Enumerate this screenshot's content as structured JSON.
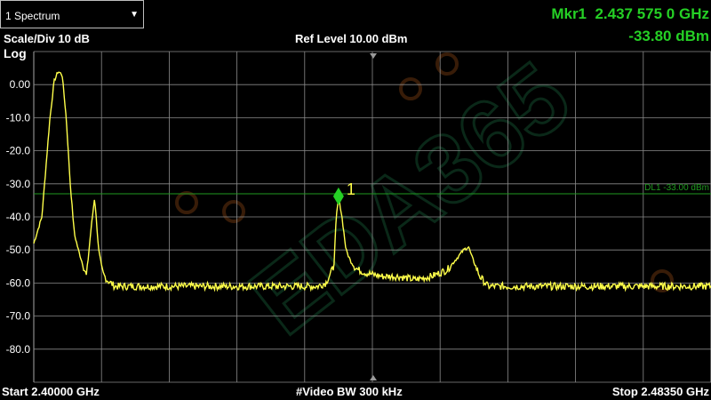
{
  "window": {
    "dropdown_label": "1 Spectrum"
  },
  "header": {
    "scale": "Scale/Div 10 dB",
    "ref_level": "Ref Level 10.00 dBm",
    "log": "Log",
    "marker_freq": "Mkr1  2.437 575 0 GHz",
    "marker_amp": "-33.80 dBm"
  },
  "footer": {
    "start": "Start 2.40000 GHz",
    "vbw": "#Video BW 300 kHz",
    "stop": "Stop 2.48350 GHz"
  },
  "display_line": {
    "label": "DL1 -33.00 dBm",
    "level": -33
  },
  "marker": {
    "label": "1",
    "freq_ghz": 2.437575,
    "amp_dbm": -33.8
  },
  "watermark": "EDA365",
  "colors": {
    "trace": "#ffff4a",
    "grid": "#8a8a8a",
    "marker": "#25d025",
    "display_line": "#1f9a1f"
  },
  "chart_data": {
    "type": "line",
    "x_unit": "GHz",
    "y_unit": "dBm",
    "xlim": [
      2.4,
      2.4835
    ],
    "ylim": [
      -90,
      10
    ],
    "yticks": [
      0,
      -10,
      -20,
      -30,
      -40,
      -50,
      -60,
      -70,
      -80
    ],
    "ytick_labels": [
      "0.00",
      "-10.0",
      "-20.0",
      "-30.0",
      "-40.0",
      "-50.0",
      "-60.0",
      "-70.0",
      "-80.0"
    ],
    "series": [
      {
        "x": [
          2.4,
          2.401,
          2.402,
          2.4025,
          2.403,
          2.4035,
          2.404,
          2.4045,
          2.405,
          2.4055,
          2.406,
          2.4065,
          2.407,
          2.4075,
          2.408,
          2.4085,
          2.409,
          2.4095,
          2.41,
          2.412,
          2.415,
          2.42,
          2.425,
          2.43,
          2.435,
          2.436,
          2.437,
          2.4373,
          2.4376,
          2.438,
          2.4385,
          2.439,
          2.4395,
          2.44,
          2.441,
          2.443,
          2.445,
          2.447,
          2.449,
          2.451,
          2.452,
          2.453,
          2.4536,
          2.454,
          2.455,
          2.456,
          2.457,
          2.459,
          2.465,
          2.47,
          2.475,
          2.48,
          2.4835
        ],
        "y": [
          -48,
          -40,
          -10,
          1,
          4,
          3,
          -10,
          -30,
          -45,
          -50,
          -54,
          -58,
          -45,
          -34,
          -50,
          -57,
          -59,
          -60,
          -61,
          -61,
          -61,
          -61,
          -61,
          -61,
          -61,
          -60,
          -55,
          -40,
          -34,
          -40,
          -50,
          -53,
          -55,
          -56,
          -57,
          -58,
          -58,
          -59,
          -58,
          -56,
          -53,
          -50,
          -49,
          -52,
          -58,
          -61,
          -61,
          -61,
          -61,
          -61,
          -61,
          -61,
          -61
        ]
      }
    ]
  }
}
